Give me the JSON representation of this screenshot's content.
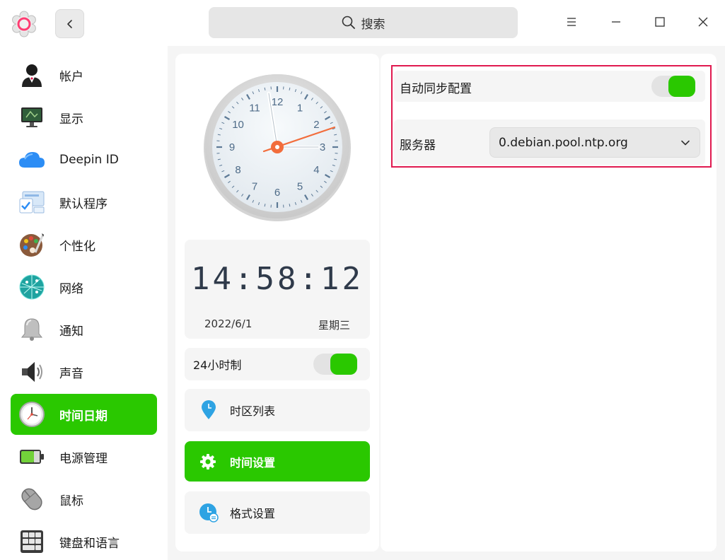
{
  "header": {
    "search_label": "搜索"
  },
  "sidebar": {
    "items": [
      {
        "label": "帐户"
      },
      {
        "label": "显示"
      },
      {
        "label": "Deepin ID"
      },
      {
        "label": "默认程序"
      },
      {
        "label": "个性化"
      },
      {
        "label": "网络"
      },
      {
        "label": "通知"
      },
      {
        "label": "声音"
      },
      {
        "label": "时间日期"
      },
      {
        "label": "电源管理"
      },
      {
        "label": "鼠标"
      },
      {
        "label": "键盘和语言"
      }
    ],
    "active_index": 8
  },
  "clock": {
    "numbers": [
      "12",
      "1",
      "2",
      "3",
      "4",
      "5",
      "6",
      "7",
      "8",
      "9",
      "10",
      "11"
    ]
  },
  "datetime": {
    "time": "14:58:12",
    "date": "2022/6/1",
    "weekday": "星期三",
    "hour24_label": "24小时制",
    "hour24_on": true
  },
  "menu": {
    "timezone_list": "时区列表",
    "time_settings": "时间设置",
    "format_settings": "格式设置"
  },
  "settings": {
    "auto_sync_label": "自动同步配置",
    "auto_sync_on": true,
    "server_label": "服务器",
    "server_value": "0.debian.pool.ntp.org"
  },
  "colors": {
    "accent": "#2ac800",
    "highlight": "#e0194f"
  }
}
